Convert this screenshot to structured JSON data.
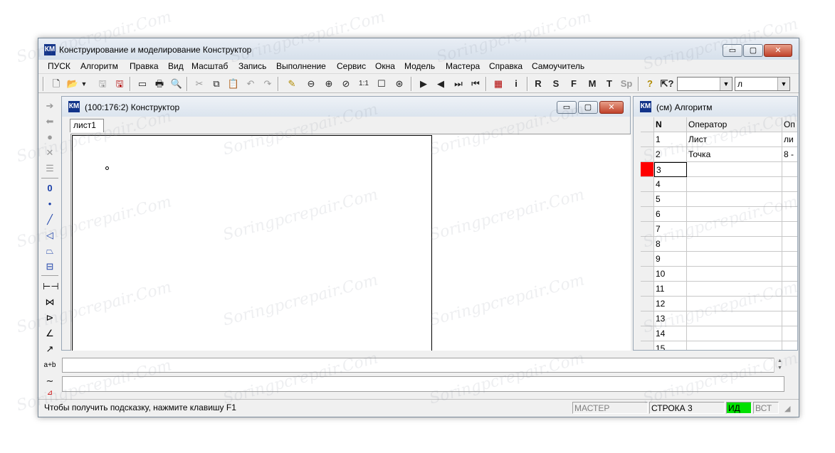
{
  "window": {
    "title": "Конструирование и моделирование  Конструктор",
    "app_icon": "КМ",
    "minimize_glyph": "▭",
    "maximize_glyph": "▢",
    "close_glyph": "✕"
  },
  "menu": [
    "ПУСК",
    "Алгоритм",
    "Правка",
    "Вид",
    "Масштаб",
    "Запись",
    "Выполнение",
    "Сервис",
    "Окна",
    "Модель",
    "Мастера",
    "Справка",
    "Самоучитель"
  ],
  "toolbar": {
    "letters": [
      "R",
      "S",
      "F",
      "M",
      "T",
      "Sp"
    ],
    "info_label": "i",
    "combo1_value": "",
    "combo2_value": "л"
  },
  "constructor_window": {
    "title": "(100:176:2) Конструктор",
    "sheet_tab": "лист1"
  },
  "algorithm_window": {
    "title": "(см) Алгоритм",
    "columns": [
      "N",
      "Оператор",
      "Оп"
    ],
    "rows": [
      {
        "n": "1",
        "op": "Лист",
        "arg": "ли"
      },
      {
        "n": "2",
        "op": "Точка",
        "arg": "8 -"
      },
      {
        "n": "3",
        "op": "",
        "arg": ""
      },
      {
        "n": "4",
        "op": "",
        "arg": ""
      },
      {
        "n": "5",
        "op": "",
        "arg": ""
      },
      {
        "n": "6",
        "op": "",
        "arg": ""
      },
      {
        "n": "7",
        "op": "",
        "arg": ""
      },
      {
        "n": "8",
        "op": "",
        "arg": ""
      },
      {
        "n": "9",
        "op": "",
        "arg": ""
      },
      {
        "n": "10",
        "op": "",
        "arg": ""
      },
      {
        "n": "11",
        "op": "",
        "arg": ""
      },
      {
        "n": "12",
        "op": "",
        "arg": ""
      },
      {
        "n": "13",
        "op": "",
        "arg": ""
      },
      {
        "n": "14",
        "op": "",
        "arg": ""
      },
      {
        "n": "15",
        "op": "",
        "arg": ""
      }
    ],
    "current_row": 3,
    "current_marker_color": "#ff0000"
  },
  "left_tools": {
    "ab_label": "a+b",
    "zero_label": "0"
  },
  "status": {
    "hint": "Чтобы получить подсказку, нажмите клавишу F1",
    "master": "МАСТЕР",
    "row": "СТРОКА 3",
    "id": "ИД",
    "vst": "ВСТ",
    "id_color": "#00e000"
  },
  "watermark": "Soringpcrepair.Com"
}
